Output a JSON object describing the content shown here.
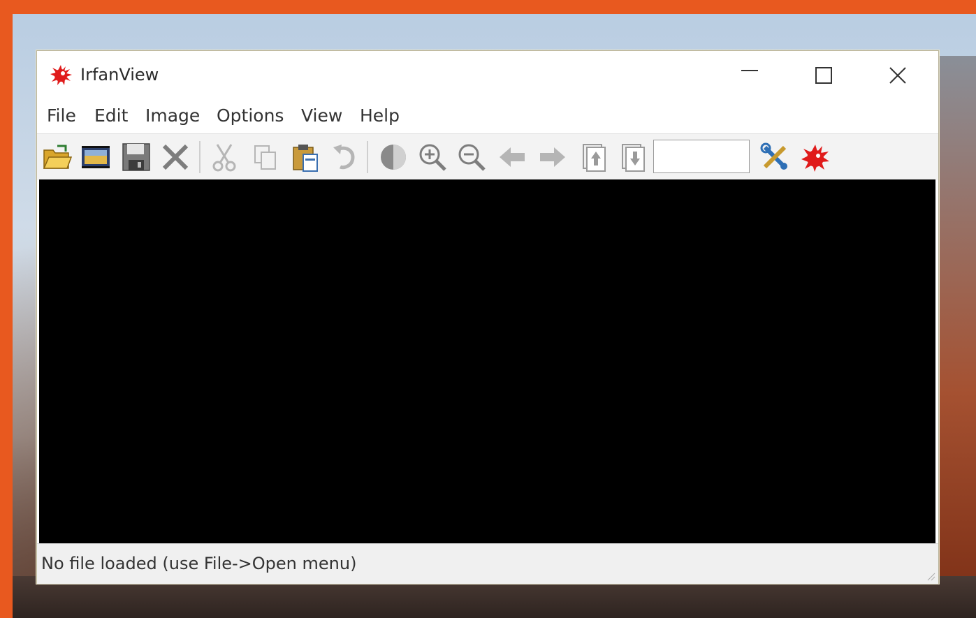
{
  "window": {
    "title": "IrfanView",
    "controls": {
      "minimize": "minimize-icon",
      "maximize": "maximize-icon",
      "close": "close-icon"
    }
  },
  "menu": {
    "items": [
      {
        "label": "File"
      },
      {
        "label": "Edit"
      },
      {
        "label": "Image"
      },
      {
        "label": "Options"
      },
      {
        "label": "View"
      },
      {
        "label": "Help"
      }
    ]
  },
  "toolbar": {
    "buttons": [
      {
        "icon": "open-folder-icon"
      },
      {
        "icon": "slideshow-icon"
      },
      {
        "icon": "save-icon"
      },
      {
        "icon": "delete-icon"
      },
      {
        "icon": "cut-icon"
      },
      {
        "icon": "copy-icon"
      },
      {
        "icon": "paste-icon"
      },
      {
        "icon": "undo-icon"
      },
      {
        "icon": "fit-image-icon"
      },
      {
        "icon": "zoom-in-icon"
      },
      {
        "icon": "zoom-out-icon"
      },
      {
        "icon": "previous-icon"
      },
      {
        "icon": "next-icon"
      },
      {
        "icon": "page-up-icon"
      },
      {
        "icon": "page-down-icon"
      },
      {
        "icon": "properties-icon"
      },
      {
        "icon": "about-icon"
      }
    ],
    "zoom_value": ""
  },
  "statusbar": {
    "text": "No file loaded (use File->Open menu)"
  },
  "colors": {
    "frame": "#e8591f",
    "canvas": "#000000",
    "toolbar_bg": "#f3f3f3",
    "logo_red": "#e01b1b"
  }
}
